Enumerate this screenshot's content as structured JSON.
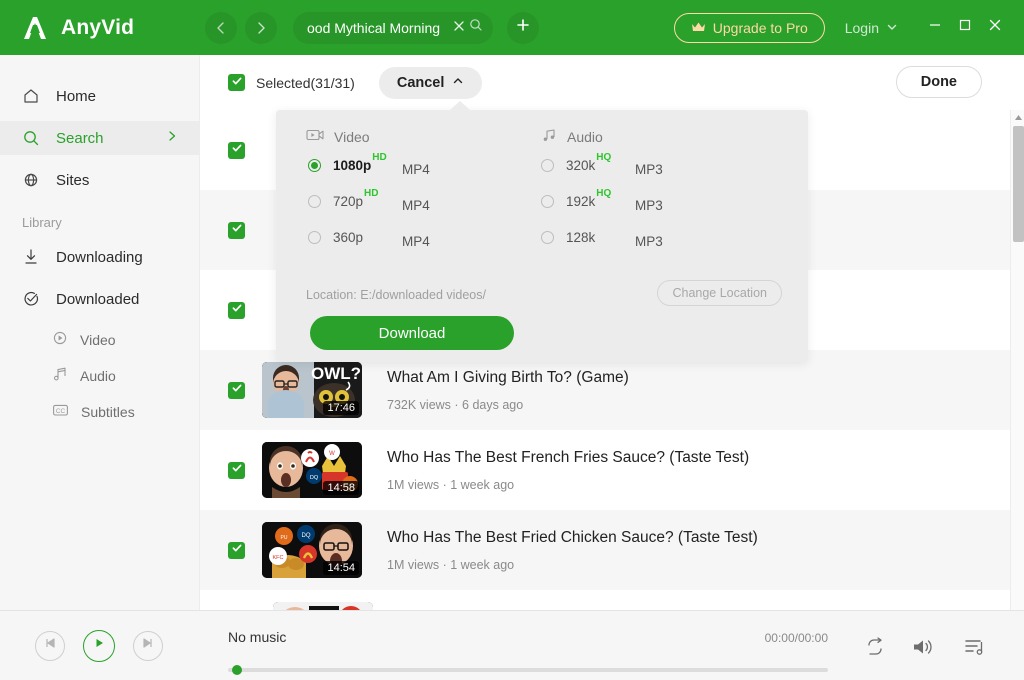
{
  "app": {
    "brand": "AnyVid",
    "brand_color": "#2aa12a"
  },
  "titlebar": {
    "back_icon": "chevron-left-icon",
    "forward_icon": "chevron-right-icon",
    "search_value": "ood Mythical Morning",
    "search_clear_icon": "close-icon",
    "search_icon": "search-icon",
    "add_tab_icon": "plus-icon",
    "upgrade_label": "Upgrade to Pro",
    "upgrade_icon": "crown-icon",
    "upgrade_color": "#ffd9a8",
    "login_label": "Login",
    "login_caret_icon": "chevron-down-icon",
    "minimize_icon": "minimize-icon",
    "maximize_icon": "maximize-icon",
    "close_icon": "close-icon"
  },
  "sidebar": {
    "items": [
      {
        "label": "Home",
        "icon": "home-icon",
        "active": false
      },
      {
        "label": "Search",
        "icon": "search-icon",
        "active": true,
        "chevron": "chevron-right-icon"
      },
      {
        "label": "Sites",
        "icon": "globe-icon",
        "active": false
      }
    ],
    "group_label": "Library",
    "library": [
      {
        "label": "Downloading",
        "icon": "download-icon"
      },
      {
        "label": "Downloaded",
        "icon": "check-circle-icon"
      }
    ],
    "sub_items": [
      {
        "label": "Video",
        "icon": "play-circle-icon"
      },
      {
        "label": "Audio",
        "icon": "music-note-icon"
      },
      {
        "label": "Subtitles",
        "icon": "closed-caption-icon"
      }
    ]
  },
  "toolbar": {
    "selected_label": "Selected(31/31)",
    "checkbox_icon": "checkmark-icon",
    "cancel_label": "Cancel",
    "cancel_caret_icon": "chevron-up-icon",
    "done_label": "Done"
  },
  "download_panel": {
    "video_header": "Video",
    "video_header_icon": "video-camera-icon",
    "audio_header": "Audio",
    "audio_header_icon": "music-note-icon",
    "video_options": [
      {
        "name": "1080p",
        "badge": "HD",
        "format": "MP4",
        "selected": true
      },
      {
        "name": "720p",
        "badge": "HD",
        "format": "MP4",
        "selected": false
      },
      {
        "name": "360p",
        "badge": "",
        "format": "MP4",
        "selected": false
      }
    ],
    "audio_options": [
      {
        "name": "320k",
        "badge": "HQ",
        "format": "MP3",
        "selected": false
      },
      {
        "name": "192k",
        "badge": "HQ",
        "format": "MP3",
        "selected": false
      },
      {
        "name": "128k",
        "badge": "",
        "format": "MP3",
        "selected": false
      }
    ],
    "location_label": "Location: E:/downloaded videos/",
    "change_location_label": "Change Location",
    "download_label": "Download",
    "badge_color": "#2ec52e"
  },
  "video_list": {
    "rows": [
      {
        "title": "",
        "subtitle": "",
        "duration": "",
        "checked": true,
        "alt": false,
        "hidden_behind_panel": true
      },
      {
        "title": "",
        "subtitle": "",
        "duration": "",
        "checked": true,
        "alt": true,
        "hidden_behind_panel": true
      },
      {
        "title": "",
        "subtitle": "",
        "duration": "",
        "checked": true,
        "alt": false,
        "hidden_behind_panel": true
      },
      {
        "title": "What Am I Giving Birth To? (Game)",
        "subtitle": "732K views · 6 days ago",
        "duration": "17:46",
        "checked": true,
        "alt": true,
        "hidden_behind_panel": false
      },
      {
        "title": "Who Has The Best French Fries Sauce? (Taste Test)",
        "subtitle": "1M views · 1 week ago",
        "duration": "14:58",
        "checked": true,
        "alt": false,
        "hidden_behind_panel": false
      },
      {
        "title": "Who Has The Best Fried Chicken Sauce? (Taste Test)",
        "subtitle": "1M views · 1 week ago",
        "duration": "14:54",
        "checked": true,
        "alt": true,
        "hidden_behind_panel": false
      }
    ]
  },
  "scrollbar": {
    "up_arrow_icon": "caret-up-icon",
    "down_arrow_icon": "caret-down-icon"
  },
  "player": {
    "prev_icon": "skip-previous-icon",
    "play_icon": "play-icon",
    "next_icon": "skip-next-icon",
    "track_name": "No music",
    "time": "00:00/00:00",
    "repeat_icon": "repeat-icon",
    "volume_icon": "volume-icon",
    "playlist_icon": "playlist-icon"
  }
}
